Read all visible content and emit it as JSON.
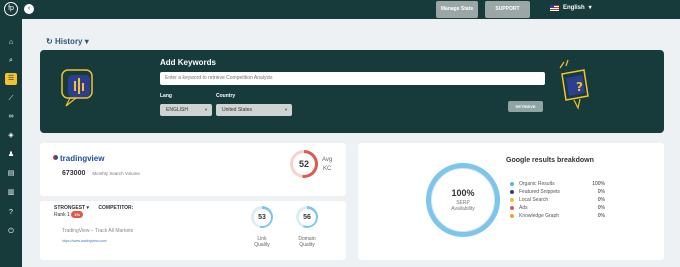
{
  "topbar": {
    "manage_btn": "Manage Stats",
    "support_btn": "SUPPORT",
    "language": "English",
    "language_caret": "▾"
  },
  "history": {
    "label": "History",
    "caret": "▾",
    "icon": "↻"
  },
  "keywords": {
    "heading": "Add Keywords",
    "input_placeholder": "Enter a keyword to retrieve Competition Analysis",
    "lang_label": "Lang",
    "lang_value": "ENGLISH",
    "country_label": "Country",
    "country_value": "United States",
    "retrieve_button": "RETRIEVE"
  },
  "competitor": {
    "name": "tradingview",
    "volume_value": "673000",
    "volume_label": "Monthly Search Volume",
    "avg_kc_value": "52",
    "avg_label": "Avg",
    "kc_label": "KC",
    "avg_kc_fraction": 0.52
  },
  "strongest": {
    "label": "STRONGEST",
    "caret": "▾",
    "competitor_label": "COMPETITOR:",
    "rank_label": "Rank 1",
    "rank_badge": "1%",
    "site_title": "TradingView – Track All Markets",
    "site_url": "https://www.tradingview.com/",
    "link_quality_value": "53",
    "link_quality_fraction": 0.53,
    "link_label": "Link",
    "link_sub": "Quality",
    "domain_quality_value": "56",
    "domain_quality_fraction": 0.56,
    "domain_label": "Domain",
    "domain_sub": "Quality"
  },
  "breakdown": {
    "title": "Google results breakdown",
    "center_value": "100%",
    "center_label_1": "SERP",
    "center_label_2": "Availability",
    "items": [
      {
        "label": "Organic Results",
        "value": "100%",
        "color": "#4fb9e0"
      },
      {
        "label": "Featured Snippets",
        "value": "0%",
        "color": "#2c3e8f"
      },
      {
        "label": "Local Search",
        "value": "0%",
        "color": "#f2c230"
      },
      {
        "label": "Ads",
        "value": "0%",
        "color": "#e3574b"
      },
      {
        "label": "Knowledge Graph",
        "value": "0%",
        "color": "#f2a030"
      }
    ]
  },
  "colors": {
    "brand": "#173a3a",
    "accent": "#f2c230",
    "ring_blue": "#7cc6ee",
    "ring_red": "#e3574b"
  },
  "sidebar": {
    "items": [
      {
        "icon": "home-icon",
        "glyph": "⌂"
      },
      {
        "icon": "search-icon",
        "glyph": "⌕"
      },
      {
        "icon": "list-icon",
        "glyph": "☰"
      },
      {
        "icon": "chart-icon",
        "glyph": "⟋"
      },
      {
        "icon": "link-icon",
        "glyph": "∞"
      },
      {
        "icon": "tag-icon",
        "glyph": "◈"
      },
      {
        "icon": "bell-icon",
        "glyph": "♟"
      },
      {
        "icon": "doc-icon",
        "glyph": "▤"
      },
      {
        "icon": "book-icon",
        "glyph": "▥"
      },
      {
        "icon": "help-icon",
        "glyph": "?"
      },
      {
        "icon": "power-icon",
        "glyph": "⏻"
      }
    ]
  }
}
